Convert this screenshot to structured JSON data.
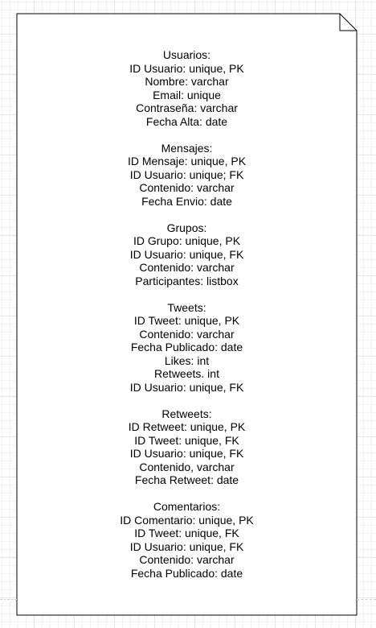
{
  "note": {
    "entities": [
      {
        "title": "Usuarios:",
        "fields": [
          "ID Usuario: unique, PK",
          "Nombre: varchar",
          "Email: unique",
          "Contraseña: varchar",
          "Fecha Alta: date"
        ]
      },
      {
        "title": "Mensajes:",
        "fields": [
          "ID Mensaje: unique, PK",
          "ID Usuario: unique; FK",
          "Contenido: varchar",
          "Fecha Envio: date"
        ]
      },
      {
        "title": "Grupos:",
        "fields": [
          "ID Grupo: unique, PK",
          "ID Usuario: unique, FK",
          "Contenido: varchar",
          "Participantes: listbox"
        ]
      },
      {
        "title": "Tweets:",
        "fields": [
          "ID Tweet: unique, PK",
          "Contenido: varchar",
          "Fecha Publicado: date",
          "Likes: int",
          "Retweets. int",
          "ID Usuario: unique, FK"
        ]
      },
      {
        "title": "Retweets:",
        "fields": [
          "ID Retweet: unique, PK",
          "ID Tweet: unique, FK",
          "ID Usuario: unique, FK",
          "Contenido, varchar",
          "Fecha Retweet: date"
        ]
      },
      {
        "title": "Comentarios:",
        "fields": [
          "ID Comentario: unique, PK",
          "ID Tweet: unique, FK",
          "ID Usuario: unique, FK",
          "Contenido: varchar",
          "Fecha Publicado: date"
        ]
      }
    ]
  }
}
